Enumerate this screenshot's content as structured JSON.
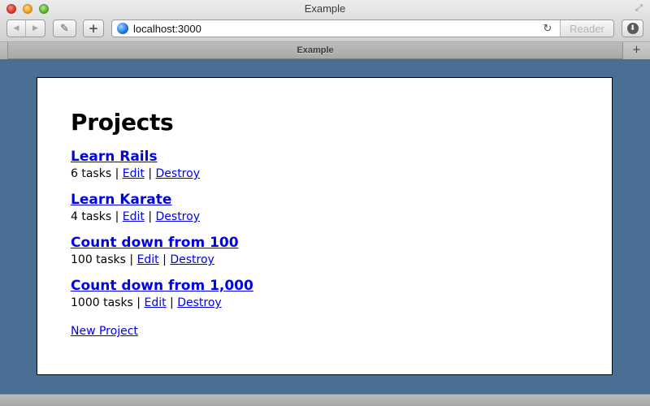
{
  "window": {
    "title": "Example",
    "icons": {
      "close": "close-window-button",
      "minimize": "minimize-window-button",
      "zoom": "zoom-window-button",
      "fullscreen": "fullscreen-arrows-icon"
    }
  },
  "toolbar": {
    "back_glyph": "◀",
    "forward_glyph": "▶",
    "share_glyph": "✎",
    "plus_glyph": "+",
    "url": "localhost:3000",
    "reload_glyph": "↻",
    "reader_label": "Reader",
    "download_glyph": "⬇"
  },
  "tabs": {
    "active_label": "Example",
    "new_tab_glyph": "+"
  },
  "page": {
    "heading": "Projects",
    "projects": [
      {
        "name": "Learn Rails",
        "tasks": "6 tasks",
        "edit_label": "Edit",
        "destroy_label": "Destroy"
      },
      {
        "name": "Learn Karate",
        "tasks": "4 tasks",
        "edit_label": "Edit",
        "destroy_label": "Destroy"
      },
      {
        "name": "Count down from 100",
        "tasks": "100 tasks",
        "edit_label": "Edit",
        "destroy_label": "Destroy"
      },
      {
        "name": "Count down from 1,000",
        "tasks": "1000 tasks",
        "edit_label": "Edit",
        "destroy_label": "Destroy"
      }
    ],
    "separator": "|",
    "new_project_label": "New Project"
  },
  "colors": {
    "link": "#0000ee",
    "desktop_background": "#4a6e94"
  }
}
